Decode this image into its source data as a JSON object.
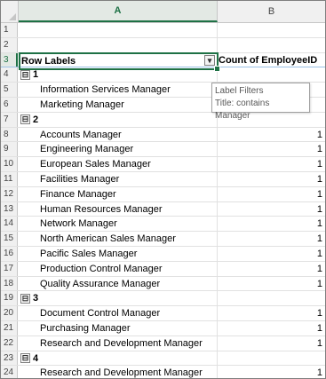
{
  "columns": {
    "a": "A",
    "b": "B"
  },
  "header": {
    "row_labels": "Row Labels",
    "count": "Count of EmployeeID"
  },
  "rows": [
    {
      "num": "1"
    },
    {
      "num": "2"
    },
    {
      "num": "3"
    },
    {
      "num": "4",
      "group": "1"
    },
    {
      "num": "5",
      "label": "Information Services Manager",
      "value": ""
    },
    {
      "num": "6",
      "label": "Marketing Manager",
      "value": ""
    },
    {
      "num": "7",
      "group": "2"
    },
    {
      "num": "8",
      "label": "Accounts Manager",
      "value": "1"
    },
    {
      "num": "9",
      "label": "Engineering Manager",
      "value": "1"
    },
    {
      "num": "10",
      "label": "European Sales Manager",
      "value": "1"
    },
    {
      "num": "11",
      "label": "Facilities Manager",
      "value": "1"
    },
    {
      "num": "12",
      "label": "Finance Manager",
      "value": "1"
    },
    {
      "num": "13",
      "label": "Human Resources Manager",
      "value": "1"
    },
    {
      "num": "14",
      "label": "Network Manager",
      "value": "1"
    },
    {
      "num": "15",
      "label": "North American Sales Manager",
      "value": "1"
    },
    {
      "num": "16",
      "label": "Pacific Sales Manager",
      "value": "1"
    },
    {
      "num": "17",
      "label": "Production Control Manager",
      "value": "1"
    },
    {
      "num": "18",
      "label": "Quality Assurance Manager",
      "value": "1"
    },
    {
      "num": "19",
      "group": "3"
    },
    {
      "num": "20",
      "label": "Document Control Manager",
      "value": "1"
    },
    {
      "num": "21",
      "label": "Purchasing Manager",
      "value": "1"
    },
    {
      "num": "22",
      "label": "Research and Development Manager",
      "value": "1"
    },
    {
      "num": "23",
      "group": "4"
    },
    {
      "num": "24",
      "label": "Research and Development Manager",
      "value": "1"
    }
  ],
  "tooltip": {
    "title": "Label Filters",
    "body": "Title: contains Manager"
  },
  "icons": {
    "collapse": "⊟",
    "filter": "filter-dropdown-icon"
  }
}
